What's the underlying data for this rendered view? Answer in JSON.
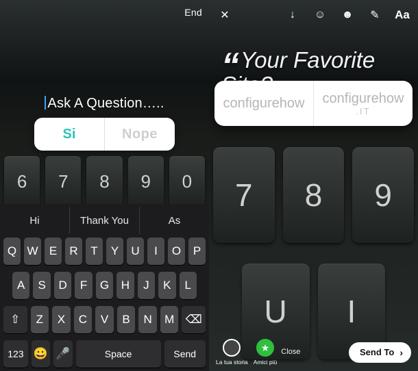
{
  "left": {
    "end_label": "End",
    "question_placeholder": "Ask A Question…..",
    "poll": {
      "yes": "Si",
      "no": "Nope"
    },
    "bg_keys_top": [
      "6",
      "7",
      "8",
      "9",
      "0"
    ],
    "bg_keys_bot": [
      "",
      "",
      "",
      "",
      ""
    ],
    "suggestions": [
      "Hi",
      "Thank You",
      "As"
    ],
    "keyboard": {
      "row1": [
        "Q",
        "W",
        "E",
        "R",
        "T",
        "Y",
        "U",
        "I",
        "O",
        "P"
      ],
      "row2": [
        "A",
        "S",
        "D",
        "F",
        "G",
        "H",
        "J",
        "K",
        "L"
      ],
      "row3_keys": [
        "Z",
        "X",
        "C",
        "V",
        "B",
        "N",
        "M"
      ],
      "shift": "⇧",
      "backspace": "⌫",
      "numbers": "123",
      "emoji": "😀",
      "mic": "🎤",
      "space": "Space",
      "send": "Send"
    }
  },
  "right": {
    "headline": "Your Favorite Site?",
    "poll": {
      "left": "configurehow",
      "right_top": "configurehow",
      "right_sub": ".IT"
    },
    "bg_keys_top": [
      "7",
      "8",
      "9"
    ],
    "bg_keys_bot": [
      "U",
      "I"
    ],
    "toolbar": {
      "close": "✕",
      "download": "↓",
      "face": "☺",
      "sticker": "☻",
      "draw": "✎",
      "text": "Aa"
    },
    "share": {
      "your_story": "La tua storia",
      "close_friends": "Amici più",
      "close": "Close",
      "send_to": "Send To",
      "chevron": "›"
    }
  }
}
